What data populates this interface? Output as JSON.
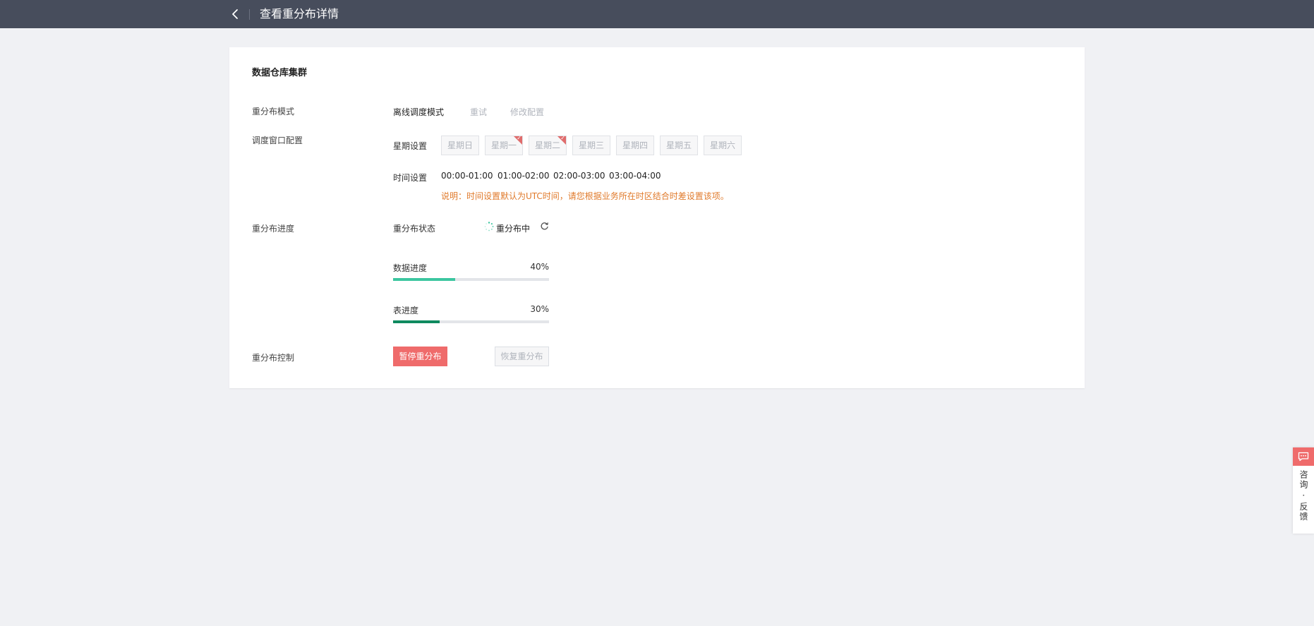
{
  "header": {
    "title": "查看重分布详情"
  },
  "card": {
    "section_title": "数据仓库集群",
    "mode": {
      "label": "重分布模式",
      "value": "离线调度模式",
      "actions": [
        "重试",
        "修改配置"
      ]
    },
    "schedule": {
      "label": "调度窗口配置",
      "week_label": "星期设置",
      "weekdays": [
        {
          "label": "星期日",
          "checked": false
        },
        {
          "label": "星期一",
          "checked": true
        },
        {
          "label": "星期二",
          "checked": true
        },
        {
          "label": "星期三",
          "checked": false
        },
        {
          "label": "星期四",
          "checked": false
        },
        {
          "label": "星期五",
          "checked": false
        },
        {
          "label": "星期六",
          "checked": false
        }
      ],
      "time_label": "时间设置",
      "times": [
        "00:00-01:00",
        "01:00-02:00",
        "02:00-03:00",
        "03:00-04:00"
      ],
      "note": "说明：时间设置默认为UTC时间，请您根据业务所在时区结合时差设置该项。"
    },
    "progress": {
      "label": "重分布进度",
      "status_label": "重分布状态",
      "status_value": "重分布中",
      "data_label": "数据进度",
      "data_percent_text": "40%",
      "data_percent": 40,
      "table_label": "表进度",
      "table_percent_text": "30%",
      "table_percent": 30
    },
    "control": {
      "label": "重分布控制",
      "pause_button": "暂停重分布",
      "resume_button": "恢复重分布"
    }
  },
  "feedback": {
    "text": "咨询 · 反馈"
  },
  "colors": {
    "header_bg": "#474d5c",
    "accent_red": "#ef6b6b",
    "data_bar": "#3cc6a0",
    "table_bar": "#0f8a5f",
    "note": "#e07a2b"
  }
}
